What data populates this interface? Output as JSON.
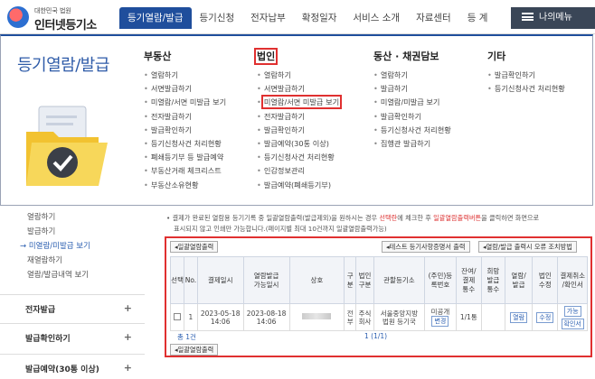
{
  "header": {
    "logo_small": "대한민국 법원",
    "logo_big": "인터넷등기소",
    "menu": [
      "등기열람/발급",
      "등기신청",
      "전자납부",
      "확정일자",
      "서비스 소개",
      "자료센터",
      "등 계"
    ],
    "my_menu": "나의메뉴"
  },
  "mega": {
    "title": "등기열람/발급",
    "columns": [
      {
        "heading": "부동산",
        "items": [
          "열람하기",
          "서면발급하기",
          "미열람/서면 미발급 보기",
          "전자발급하기",
          "발급확인하기",
          "등기신청사건 처리현황",
          "폐쇄등기부 등 발급예약",
          "부동산거래 체크리스트",
          "부동산소유현황"
        ]
      },
      {
        "heading": "법인",
        "items": [
          "열람하기",
          "서면발급하기",
          "미열람/서면 미발급 보기",
          "전자발급하기",
          "발급확인하기",
          "발급예약(30통 이상)",
          "등기신청사건 처리현황",
          "인감정보관리",
          "발급예약(폐쇄등기부)"
        ]
      },
      {
        "heading": "동산 · 채권담보",
        "items": [
          "열람하기",
          "발급하기",
          "미열람/미발급 보기",
          "발급확인하기",
          "등기신청사건 처리현황",
          "집행관 발급하기"
        ]
      },
      {
        "heading": "기타",
        "items": [
          "발급확인하기",
          "등기신청사건 처리현황"
        ]
      }
    ]
  },
  "left_nav": {
    "sub_items": [
      "열람하기",
      "발급하기",
      "→ 미열람/미발급 보기",
      "재열람하기",
      "열람/발급내역 보기"
    ],
    "sections": [
      "전자발급",
      "발급확인하기",
      "발급예약(30통 이상)"
    ]
  },
  "notice": {
    "line1_pre": "• 결제가 완료된 열람용 등기기록 중 일괄열람출력(발급제외)을 원하시는 경우 ",
    "line1_red1": "선택란",
    "line1_mid": "에 체크한 후 ",
    "line1_red2": "일괄열람출력버튼",
    "line1_post": "을 클릭하면 화면으로",
    "line2": "표시되지 않고 인쇄만 가능합니다.(페이지별 최대 10건까지 일괄열람출력가능)"
  },
  "toolbar": {
    "batch_print": "일괄열람출력",
    "test_print": "테스트 등기사항증명서 출력",
    "print_error": "열람/발급 출력시 오류 조치방법"
  },
  "table": {
    "headers": [
      "선택",
      "No.",
      "결제일시",
      "열람발급\n가능일시",
      "상호",
      "구분",
      "법인\n구분",
      "관할등기소",
      "(주민)등\n록번호",
      "잔여/\n결제\n통수",
      "희망\n발급\n통수",
      "열람/\n발급",
      "법인\n수정",
      "결제취소\n/확인서"
    ],
    "row": {
      "no": "1",
      "paid_at": "2023-05-18\n14:06",
      "available_at": "2023-08-18\n14:06",
      "type": "전\n부",
      "corp_type": "주식\n회사",
      "registry": "서울중앙지방\n법원 등기국",
      "reg_no": "미공개",
      "reg_btn": "변경",
      "remain": "1/1통",
      "view_btn": "열람",
      "edit_btn": "수정",
      "cancel_btn": "가능",
      "confirm_btn": "확인서"
    },
    "total": "총 1건",
    "page": "1 (1/1)"
  }
}
